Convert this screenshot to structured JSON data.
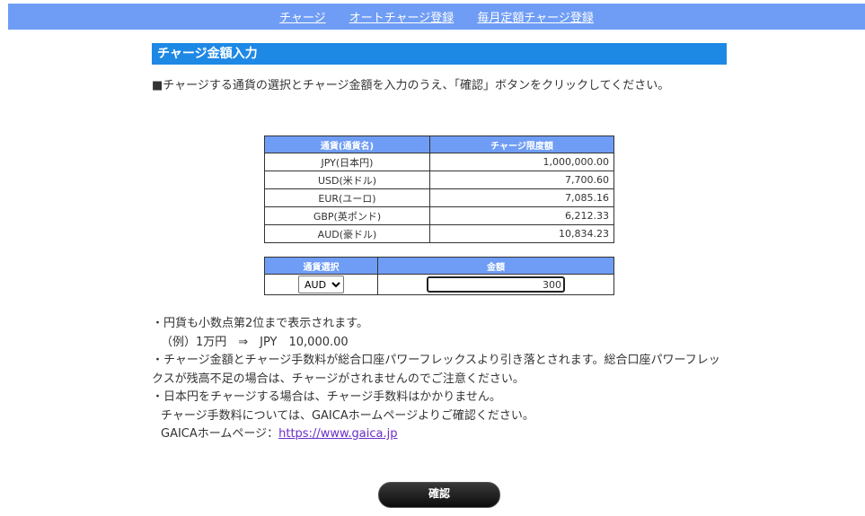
{
  "nav": {
    "items": [
      "チャージ",
      "オートチャージ登録",
      "毎月定額チャージ登録"
    ]
  },
  "section": {
    "title": "チャージ金額入力",
    "instruction": "■チャージする通貨の選択とチャージ金額を入力のうえ、「確認」ボタンをクリックしてください。"
  },
  "limits_table": {
    "headers": [
      "通貨(通貨名)",
      "チャージ限度額"
    ],
    "rows": [
      {
        "currency": "JPY(日本円)",
        "limit": "1,000,000.00"
      },
      {
        "currency": "USD(米ドル)",
        "limit": "7,700.60"
      },
      {
        "currency": "EUR(ユーロ)",
        "limit": "7,085.16"
      },
      {
        "currency": "GBP(英ポンド)",
        "limit": "6,212.33"
      },
      {
        "currency": "AUD(豪ドル)",
        "limit": "10,834.23"
      }
    ]
  },
  "input_table": {
    "headers": [
      "通貨選択",
      "金額"
    ],
    "currency_selected": "AUD",
    "amount_value": "300"
  },
  "notes": {
    "line1": "・円貨も小数点第2位まで表示されます。",
    "line2": "（例）1万円　⇒　JPY　10,000.00",
    "line3": "・チャージ金額とチャージ手数料が総合口座パワーフレックスより引き落とされます。総合口座パワーフレックスが残高不足の場合は、チャージがされませんのでご注意ください。",
    "line4": "・日本円をチャージする場合は、チャージ手数料はかかりません。",
    "line5": "チャージ手数料については、GAICAホームページよりご確認ください。",
    "line6_prefix": "GAICAホームページ：",
    "link": "https://www.gaica.jp"
  },
  "buttons": {
    "confirm": "確認"
  }
}
